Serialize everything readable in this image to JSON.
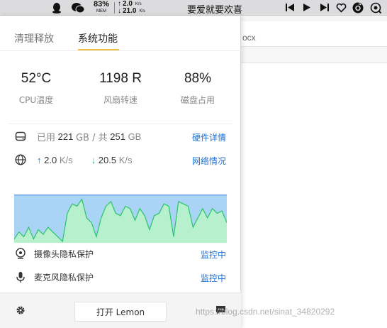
{
  "menubar": {
    "mem_percent": "83%",
    "mem_label": "MEM",
    "net_up": "2.0",
    "net_down": "21.0",
    "net_unit": "K/s",
    "song": "要爱就要欢喜"
  },
  "background_window": {
    "title_fragment": "ocx"
  },
  "tabs": [
    {
      "label": "清理释放"
    },
    {
      "label": "系统功能"
    }
  ],
  "stats": [
    {
      "value": "52°C",
      "label": "CPU温度"
    },
    {
      "value": "1198 R",
      "label": "风扇转速"
    },
    {
      "value": "88%",
      "label": "磁盘占用"
    }
  ],
  "disk": {
    "used_label": "已用",
    "used_value": "221",
    "unit1": "GB / 共",
    "total_value": "251",
    "unit2": "GB",
    "link": "硬件详情"
  },
  "network": {
    "up": "2.0",
    "down": "20.5",
    "unit": "K/s",
    "link": "网络情况"
  },
  "chart_data": {
    "type": "area",
    "series": [
      {
        "values": [
          0.99,
          0.99,
          0.99,
          0.99,
          0.99,
          0.99,
          0.99,
          0.99,
          0.99,
          0.99,
          0.99,
          0.99,
          0.99,
          0.99,
          0.99,
          0.99,
          0.99,
          0.99,
          0.99,
          0.99,
          0.99,
          0.99,
          0.99,
          0.99,
          0.99,
          0.99,
          0.99,
          0.99,
          0.99,
          0.99,
          0.99,
          0.99,
          0.99,
          0.99,
          0.99,
          0.99,
          0.99,
          0.99,
          0.99,
          0.99,
          0.99,
          0.99,
          0.99,
          0.99,
          0.99
        ],
        "color": "#4a90e2"
      },
      {
        "values": [
          0.05,
          0.2,
          0.1,
          0.3,
          0.05,
          0.25,
          0.15,
          0.3,
          0.2,
          0.1,
          0.0,
          0.6,
          0.8,
          0.75,
          0.9,
          0.5,
          0.4,
          0.1,
          0.5,
          0.75,
          0.85,
          0.6,
          0.55,
          0.75,
          0.7,
          0.45,
          0.7,
          0.55,
          0.25,
          0.55,
          0.6,
          0.8,
          0.75,
          0.1,
          0.85,
          0.8,
          0.75,
          0.3,
          0.5,
          0.7,
          0.5,
          0.7,
          0.6,
          0.65,
          0.4
        ],
        "color": "#2bc46a"
      }
    ],
    "colors": {
      "top": "#a9d4f5",
      "fill": "#b6f0cc"
    }
  },
  "privacy": [
    {
      "label": "摄像头隐私保护",
      "status": "监控中"
    },
    {
      "label": "麦克风隐私保护",
      "status": "监控中"
    }
  ],
  "footer": {
    "open_button": "打开 Lemon"
  },
  "watermark": "https://blog.csdn.net/sinat_34820292",
  "colors": {
    "link": "#1a6fd6",
    "accent": "#f0c040",
    "up_arrow": "#1a6fd6",
    "down_arrow": "#2bc46a"
  }
}
